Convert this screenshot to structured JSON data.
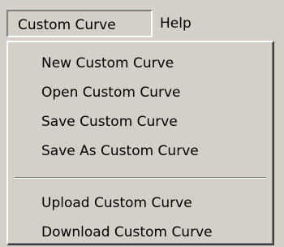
{
  "menubar": {
    "items": [
      {
        "label": "Custom Curve"
      },
      {
        "label": "Help"
      }
    ]
  },
  "dropdown": {
    "items": [
      {
        "label": "New Custom Curve"
      },
      {
        "label": "Open Custom Curve"
      },
      {
        "label": "Save Custom Curve"
      },
      {
        "label": "Save As Custom Curve"
      },
      {
        "label": "Upload Custom Curve"
      },
      {
        "label": "Download Custom Curve"
      }
    ]
  }
}
